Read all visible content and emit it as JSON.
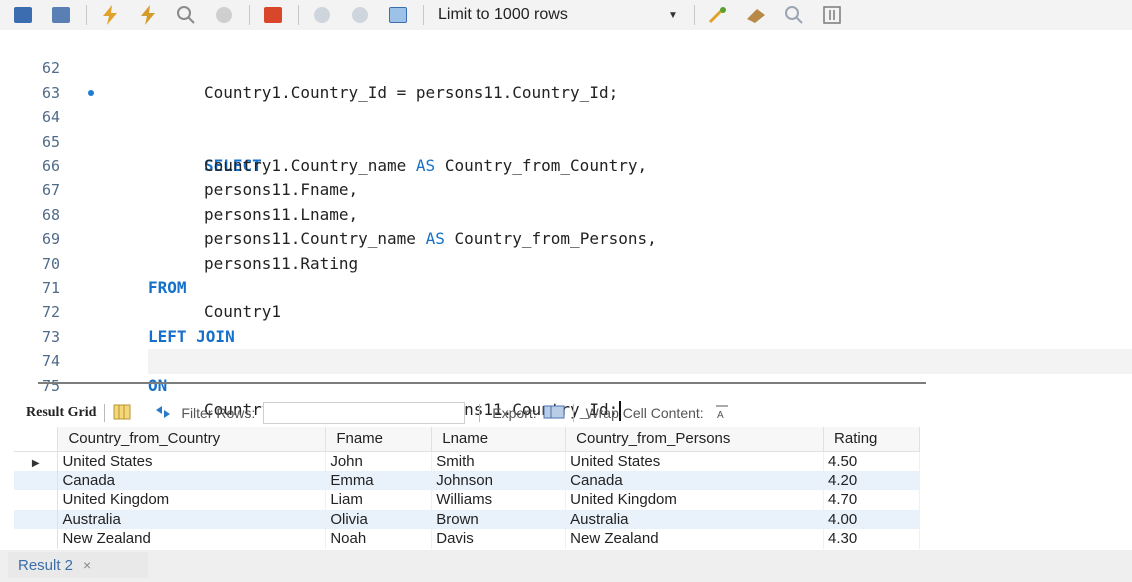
{
  "toolbar": {
    "limit_label": "Limit to 1000 rows",
    "icons": [
      "save-icon",
      "open-icon",
      "lightning-icon",
      "lightning-cursor-icon",
      "explain-icon",
      "stop-icon",
      "toggle-error-icon",
      "commit-icon",
      "rollback-icon",
      "autocommit-icon",
      "beautify-icon",
      "eraser-icon",
      "find-icon",
      "invisible-chars-icon"
    ]
  },
  "editor": {
    "lines": [
      {
        "num": "62",
        "code": "Country1.Country_Id = persons11.Country_Id;"
      },
      {
        "num": "63",
        "code": ""
      },
      {
        "num": "64",
        "kw": "SELECT"
      },
      {
        "num": "65",
        "pre": "Country1.Country_name ",
        "as": "AS",
        "post": " Country_from_Country,"
      },
      {
        "num": "66",
        "code": "persons11.Fname,"
      },
      {
        "num": "67",
        "code": "persons11.Lname,"
      },
      {
        "num": "68",
        "pre": "persons11.Country_name ",
        "as": "AS",
        "post": " Country_from_Persons,"
      },
      {
        "num": "69",
        "code": "persons11.Rating"
      },
      {
        "num": "70",
        "kw": "FROM"
      },
      {
        "num": "71",
        "code": "Country1"
      },
      {
        "num": "72",
        "kw": "LEFT JOIN"
      },
      {
        "num": "73",
        "code": "persons11"
      },
      {
        "num": "74",
        "kw": "ON"
      },
      {
        "num": "75",
        "code": "Country1.Country_Id = persons11.Country_Id;"
      }
    ]
  },
  "result_toolbar": {
    "result_grid_label": "Result Grid",
    "filter_label": "Filter Rows:",
    "filter_value": "",
    "export_label": "Export:",
    "wrap_label": "Wrap Cell Content:"
  },
  "grid": {
    "columns": [
      "Country_from_Country",
      "Fname",
      "Lname",
      "Country_from_Persons",
      "Rating"
    ],
    "rows": [
      [
        "United States",
        "John",
        "Smith",
        "United States",
        "4.50"
      ],
      [
        "Canada",
        "Emma",
        "Johnson",
        "Canada",
        "4.20"
      ],
      [
        "United Kingdom",
        "Liam",
        "Williams",
        "United Kingdom",
        "4.70"
      ],
      [
        "Australia",
        "Olivia",
        "Brown",
        "Australia",
        "4.00"
      ],
      [
        "New Zealand",
        "Noah",
        "Davis",
        "New Zealand",
        "4.30"
      ]
    ]
  },
  "tabs": {
    "result_tab": "Result 2",
    "close_glyph": "×"
  },
  "colors": {
    "keyword": "#1670c9",
    "line_number": "#4f6b88",
    "alt_row": "#e9f1fb"
  }
}
